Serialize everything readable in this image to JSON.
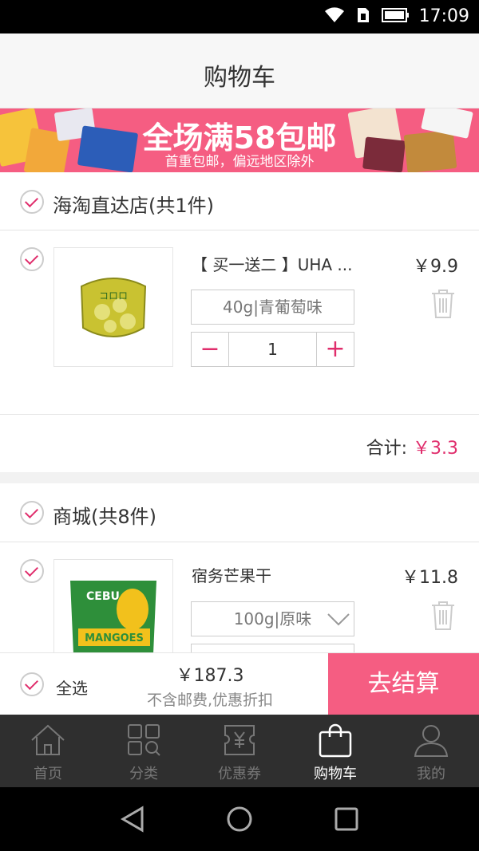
{
  "status_bar": {
    "time": "17:09"
  },
  "header": {
    "title": "购物车"
  },
  "banner": {
    "main": "全场满58包邮",
    "sub": "首重包邮，偏远地区除外"
  },
  "shops": [
    {
      "name": "海淘直达店(共1件)",
      "item": {
        "name": "【 买一送二 】UHA ...",
        "price": "￥9.9",
        "spec": "40g|青葡萄味",
        "qty": "1",
        "minus": "−",
        "plus": "+",
        "thumb_text": "コロロ"
      },
      "subtotal_label": "合计:",
      "subtotal": "￥3.3"
    },
    {
      "name": "商城(共8件)",
      "item": {
        "name": "宿务芒果干",
        "price": "￥11.8",
        "spec": "100g|原味",
        "thumb_text": "CEBU",
        "thumb_text2": "MANGOES"
      }
    }
  ],
  "checkout": {
    "select_all": "全选",
    "total": "￥187.3",
    "note": "不含邮费,优惠折扣",
    "button": "去结算"
  },
  "tabs": [
    {
      "label": "首页",
      "icon": "home-icon"
    },
    {
      "label": "分类",
      "icon": "category-icon"
    },
    {
      "label": "优惠券",
      "icon": "coupon-icon"
    },
    {
      "label": "购物车",
      "icon": "cart-bag-icon",
      "active": true
    },
    {
      "label": "我的",
      "icon": "profile-icon"
    }
  ],
  "colors": {
    "accent": "#e02d6c",
    "banner": "#f55d82",
    "tabbar": "#2f2f2f"
  }
}
